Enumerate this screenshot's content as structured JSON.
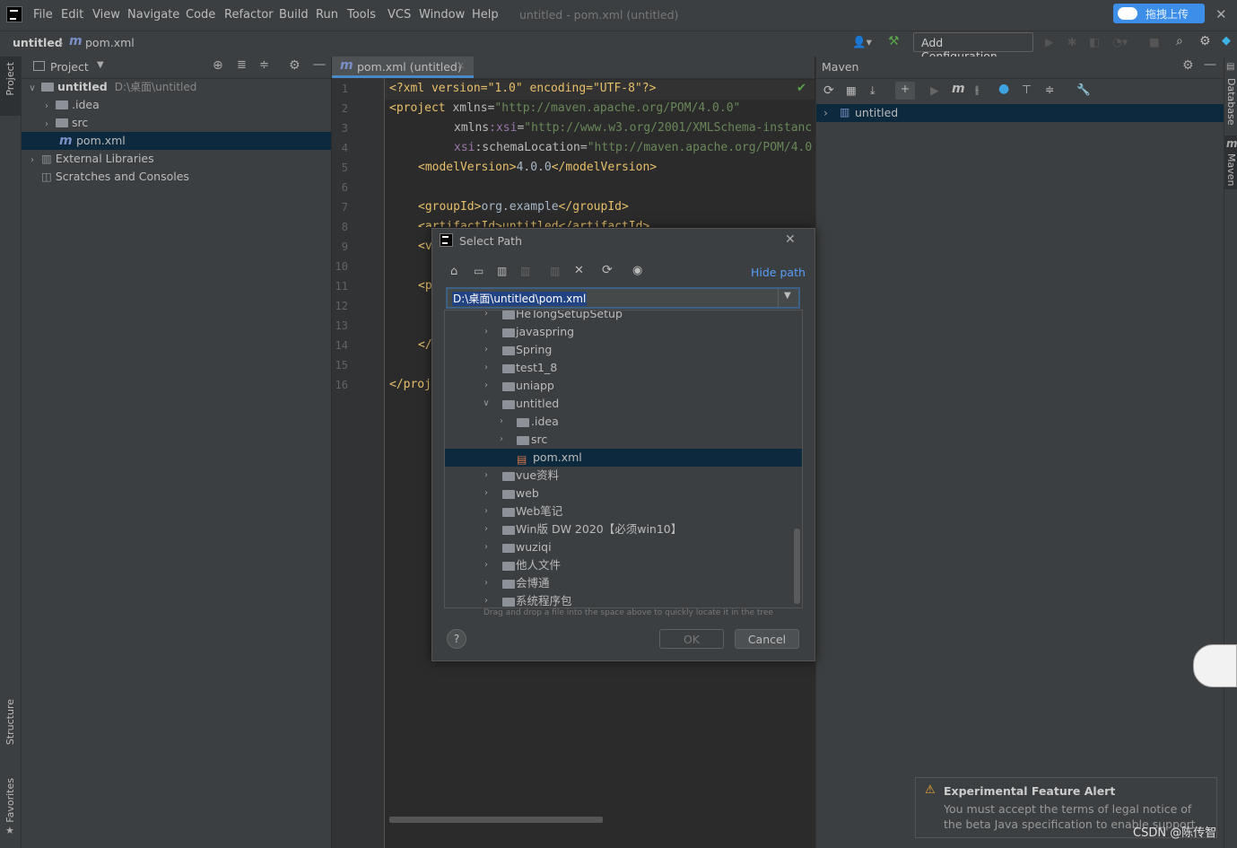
{
  "window": {
    "title": "untitled - pom.xml (untitled)",
    "menu": [
      "File",
      "Edit",
      "View",
      "Navigate",
      "Code",
      "Refactor",
      "Build",
      "Run",
      "Tools",
      "VCS",
      "Window",
      "Help"
    ],
    "upload_badge": "拖拽上传"
  },
  "navbar": {
    "project": "untitled",
    "file": "pom.xml",
    "run_config": "Add Configuration..."
  },
  "left_stripe": {
    "project": "Project",
    "structure": "Structure",
    "favorites": "Favorites"
  },
  "right_stripe": {
    "database": "Database",
    "maven": "Maven"
  },
  "project_panel": {
    "title": "Project",
    "tree": [
      {
        "label": "untitled",
        "path": "D:\\桌面\\untitled"
      },
      {
        "label": ".idea"
      },
      {
        "label": "src"
      },
      {
        "label": "pom.xml"
      },
      {
        "label": "External Libraries"
      },
      {
        "label": "Scratches and Consoles"
      }
    ]
  },
  "editor": {
    "tab": "pom.xml (untitled)",
    "line_numbers": [
      "1",
      "2",
      "3",
      "4",
      "5",
      "6",
      "7",
      "8",
      "9",
      "10",
      "11",
      "12",
      "13",
      "14",
      "15",
      "16"
    ],
    "lines": {
      "l1": "<?xml version=\"1.0\" encoding=\"UTF-8\"?>",
      "l2a": "<project ",
      "l2b": "xmlns",
      "l2c": "=",
      "l2d": "\"http://maven.apache.org/POM/4.0.0\"",
      "l3a": "xmlns",
      "l3b": ":xsi",
      "l3c": "=",
      "l3d": "\"http://www.w3.org/2001/XMLSchema-instanc",
      "l4a": "xsi",
      "l4b": ":schemaLocation",
      "l4c": "=",
      "l4d": "\"http://maven.apache.org/POM/4.0",
      "l5a": "<modelVersion>",
      "l5b": "4.0.0",
      "l5c": "</modelVersion>",
      "l7a": "<groupId>",
      "l7b": "org.example",
      "l7c": "</groupId>",
      "l8": "<artifactId>untitled</artifactId>",
      "l9": "<v",
      "l11": "<p",
      "l14": "</",
      "l16": "</proj"
    }
  },
  "maven": {
    "title": "Maven",
    "project": "untitled"
  },
  "dialog": {
    "title": "Select Path",
    "hide_path": "Hide path",
    "path_value": "D:\\桌面\\untitled\\pom.xml",
    "tree": [
      {
        "label": "HeTongSetupSetup"
      },
      {
        "label": "javaspring"
      },
      {
        "label": "Spring"
      },
      {
        "label": "test1_8"
      },
      {
        "label": "uniapp"
      },
      {
        "label": "untitled"
      },
      {
        "label": ".idea"
      },
      {
        "label": "src"
      },
      {
        "label": "pom.xml"
      },
      {
        "label": "vue资料"
      },
      {
        "label": "web"
      },
      {
        "label": "Web笔记"
      },
      {
        "label": "Win版 DW 2020【必须win10】"
      },
      {
        "label": "wuziqi"
      },
      {
        "label": "他人文件"
      },
      {
        "label": "会博通"
      },
      {
        "label": "系统程序包"
      }
    ],
    "hint": "Drag and drop a file into the space above to quickly locate it in the tree",
    "help": "?",
    "ok": "OK",
    "cancel": "Cancel"
  },
  "notification": {
    "title": "Experimental Feature Alert",
    "line1": "You must accept the terms of legal notice of",
    "line2": "the beta Java specification to enable support"
  },
  "watermark": "CSDN @陈传智",
  "colors": {
    "accent": "#4a88c7",
    "selection": "#0d293e",
    "xml_tag": "#e8bf6a",
    "xml_value": "#6a8759",
    "xml_namespace": "#9876aa"
  }
}
